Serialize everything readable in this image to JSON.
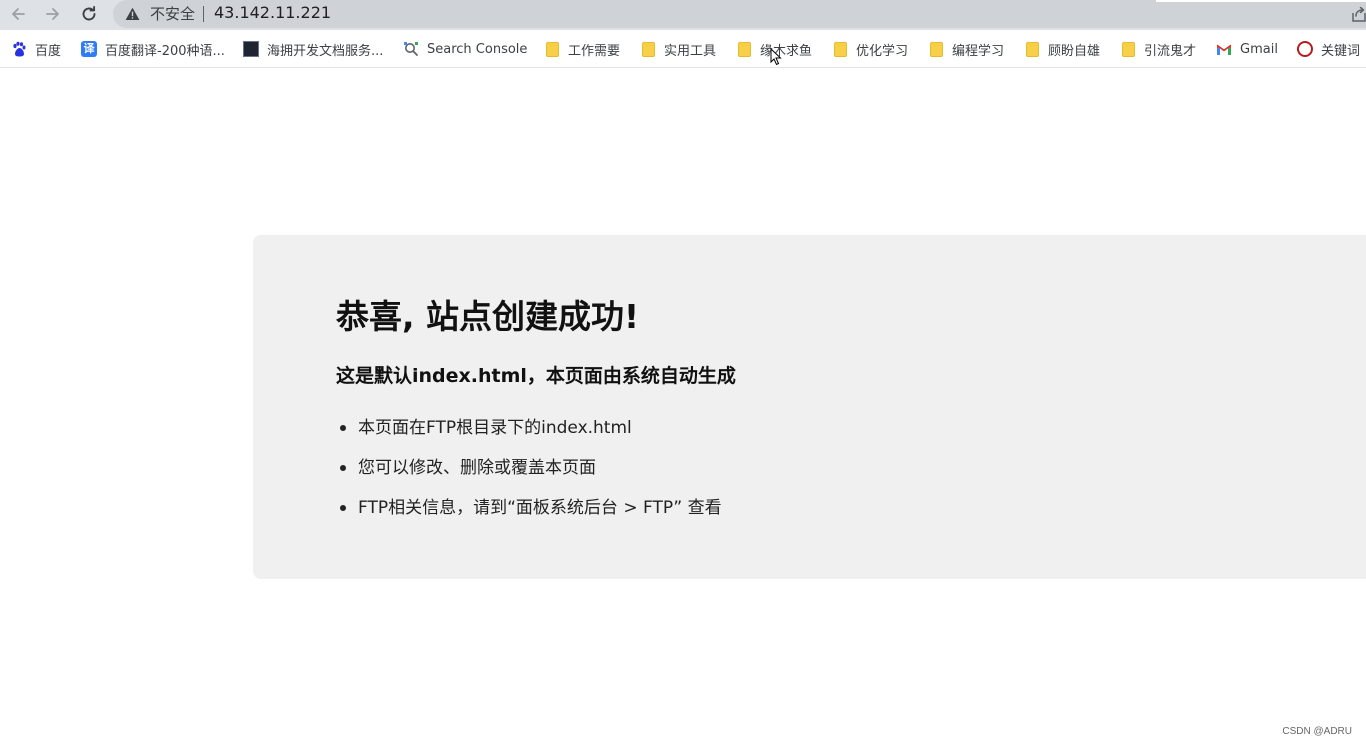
{
  "toolbar": {
    "insecure_label": "不安全",
    "url": "43.142.11.221"
  },
  "icons": {
    "back": "arrow-left-icon",
    "forward": "arrow-right-icon",
    "reload": "reload-icon",
    "warning": "warning-triangle-icon",
    "share": "share-icon"
  },
  "bookmarks": [
    {
      "label": "百度",
      "icon": "baidu-paw-icon"
    },
    {
      "label": "百度翻译-200种语...",
      "icon": "translate-icon"
    },
    {
      "label": "海拥开发文档服务...",
      "icon": "dark-square-icon"
    },
    {
      "label": "Search Console",
      "icon": "search-console-icon"
    },
    {
      "label": "工作需要",
      "icon": "folder-icon"
    },
    {
      "label": "实用工具",
      "icon": "folder-icon"
    },
    {
      "label": "缘木求鱼",
      "icon": "folder-icon"
    },
    {
      "label": "优化学习",
      "icon": "folder-icon"
    },
    {
      "label": "编程学习",
      "icon": "folder-icon"
    },
    {
      "label": "顾盼自雄",
      "icon": "folder-icon"
    },
    {
      "label": "引流鬼才",
      "icon": "folder-icon"
    },
    {
      "label": "Gmail",
      "icon": "gmail-icon"
    },
    {
      "label": "关键词",
      "icon": "avatar-icon"
    }
  ],
  "page": {
    "title": "恭喜, 站点创建成功!",
    "subtitle": "这是默认index.html，本页面由系统自动生成",
    "items": [
      "本页面在FTP根目录下的index.html",
      "您可以修改、删除或覆盖本页面",
      "FTP相关信息，请到“面板系统后台 > FTP” 查看"
    ]
  },
  "watermark": "CSDN @ADRU",
  "colors": {
    "toolbar_bg": "#dee1e6",
    "card_bg": "#f0f0f0",
    "folder": "#f9cf48"
  }
}
